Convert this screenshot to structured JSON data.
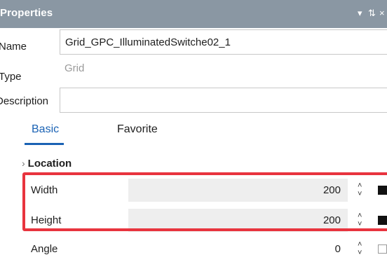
{
  "panel": {
    "title": "Properties",
    "pin_glyph": "▾ ↕",
    "close_glyph": "×"
  },
  "fields": {
    "name_label": "Name",
    "name_value": "Grid_GPC_IlluminatedSwitche02_1",
    "type_label": "Type",
    "type_value": "Grid",
    "description_label": "Description",
    "description_value": ""
  },
  "tabs": [
    {
      "label": "Basic",
      "active": true
    },
    {
      "label": "Favorite",
      "active": false
    }
  ],
  "section": {
    "chevron": "›",
    "title": "Location"
  },
  "properties": [
    {
      "label": "Width",
      "value": "200",
      "swatch_filled": true
    },
    {
      "label": "Height",
      "value": "200",
      "swatch_filled": true
    },
    {
      "label": "Angle",
      "value": "0",
      "swatch_filled": false
    }
  ],
  "spinner": {
    "up": "˄",
    "down": "˅"
  },
  "colors": {
    "titlebar": "#8a97a3",
    "accent": "#1a62b4",
    "highlight": "#e8343e"
  }
}
